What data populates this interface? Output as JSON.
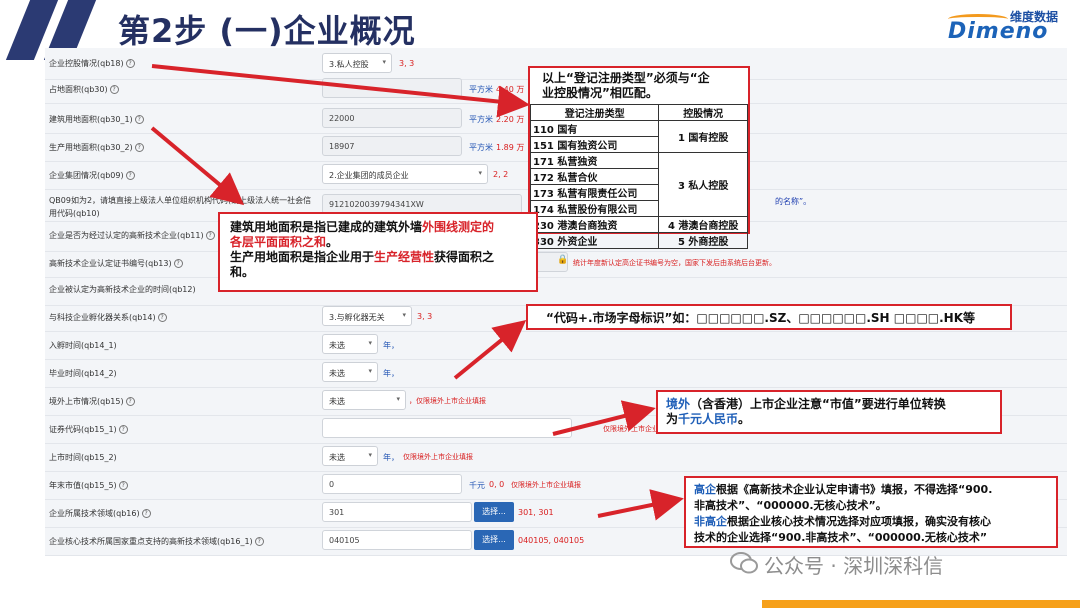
{
  "header": {
    "title": "第2步 (一)企业概况",
    "logo_cn": "维度数据",
    "logo_en": "Dimeno",
    "accent_color": "#2b3a73"
  },
  "form": {
    "rows": [
      {
        "label": "企业控股情况(qb18)",
        "value": "3.私人控股",
        "type": "select",
        "extra": "3, 3"
      },
      {
        "label": "占地面积(qb30)",
        "value": "",
        "type": "input",
        "unit": "平方米",
        "extra": "4.40 万"
      },
      {
        "label": "建筑用地面积(qb30_1)",
        "value": "22000",
        "type": "input",
        "unit": "平方米",
        "extra": "2.20 万"
      },
      {
        "label": "生产用地面积(qb30_2)",
        "value": "18907",
        "type": "input",
        "unit": "平方米",
        "extra": "1.89 万"
      },
      {
        "label": "企业集团情况(qb09)",
        "value": "2.企业集团的成员企业",
        "type": "select",
        "extra": "2, 2"
      },
      {
        "label": "QB09如为2，请填直接上级法人单位组织机构代码(或上级法人统一社会信用代码(qb10)",
        "value": "9121020039794341XW",
        "type": "input",
        "note": "的名称”。"
      },
      {
        "label": "企业是否为经过认定的高新技术企业(qb11)",
        "value": "",
        "type": "none"
      },
      {
        "label": "高新技术企业认定证书编号(qb13)",
        "value": "",
        "type": "input",
        "note": "统计年度新认定高企证书编号为空，国家下发后由系统后台更新。"
      },
      {
        "label": "企业被认定为高新技术企业的时间(qb12)",
        "value": "",
        "type": "none"
      },
      {
        "label": "与科技企业孵化器关系(qb14)",
        "value": "3.与孵化器无关",
        "type": "select",
        "extra": "3, 3"
      },
      {
        "label": "入孵时间(qb14_1)",
        "value": "未选",
        "type": "select",
        "unit": "年，"
      },
      {
        "label": "毕业时间(qb14_2)",
        "value": "未选",
        "type": "select",
        "unit": "年，"
      },
      {
        "label": "境外上市情况(qb15)",
        "value": "未选",
        "type": "select",
        "note": "，仅限境外上市企业填报"
      },
      {
        "label": "证券代码(qb15_1)",
        "value": "",
        "type": "input",
        "note": "仅限境外上市企业填报"
      },
      {
        "label": "上市时间(qb15_2)",
        "value": "未选",
        "type": "select",
        "unit": "年，",
        "note": "仅限境外上市企业填报"
      },
      {
        "label": "年末市值(qb15_5)",
        "value": "0",
        "type": "input",
        "unit": "千元",
        "extra": "0, 0",
        "note": "仅限境外上市企业填报"
      },
      {
        "label": "企业所属技术领域(qb16)",
        "value": "301",
        "type": "input",
        "button": "选择...",
        "extra": "301, 301"
      },
      {
        "label": "企业核心技术所属国家重点支持的高新技术领域(qb16_1)",
        "value": "040105",
        "type": "input",
        "button": "选择...",
        "extra": "040105, 040105"
      }
    ]
  },
  "callouts": {
    "registration": {
      "line1": "以上“登记注册类型”必须与“企",
      "line2": "业控股情况”相匹配。",
      "th_reg": "登记注册类型",
      "th_hold": "控股情况",
      "rows": [
        {
          "reg": "110 国有",
          "hold": "1 国有控股"
        },
        {
          "reg": "151 国有独资公司",
          "hold": ""
        },
        {
          "reg": "171 私营独资",
          "hold": "3 私人控股"
        },
        {
          "reg": "172 私营合伙",
          "hold": ""
        },
        {
          "reg": "173 私营有限责任公司",
          "hold": ""
        },
        {
          "reg": "174 私营股份有限公司",
          "hold": ""
        },
        {
          "reg": "230 港澳台商独资",
          "hold": "4 港澳台商控股"
        },
        {
          "reg": "330 外资企业",
          "hold": "5 外商控股"
        }
      ]
    },
    "area": {
      "p1a": "建筑用地面积是指已建成的建筑外墙",
      "p1b": "外围线测定的",
      "p1c": "各层平面面积之和",
      "p1d": "。",
      "p2a": "生产用地面积是指企业用于",
      "p2b": "生产经营性",
      "p2c": "获得面积之",
      "p2d": "和。"
    },
    "code": {
      "text": "“代码+.市场字母标识”如：□□□□□□.SZ、□□□□□□.SH □□□□.HK等"
    },
    "market": {
      "a": "境外",
      "b": "（含香港）上市企业注意“市值”要进行单位转换",
      "c": "为",
      "d": "千元人民币",
      "e": "。"
    },
    "tech": {
      "a1": "高企",
      "a2": "根据《高新技术企业认定申请书》填报，不得选择“900.",
      "a3": "非高技术”、“000000.无核心技术”。",
      "b1": "非高企",
      "b2": "根据企业核心技术情况选择对应项填报，确实没有核心",
      "b3": "技术的企业选择“900.非高技术”、“000000.无核心技术”"
    }
  },
  "watermark": "公众号 · 深圳深科信"
}
